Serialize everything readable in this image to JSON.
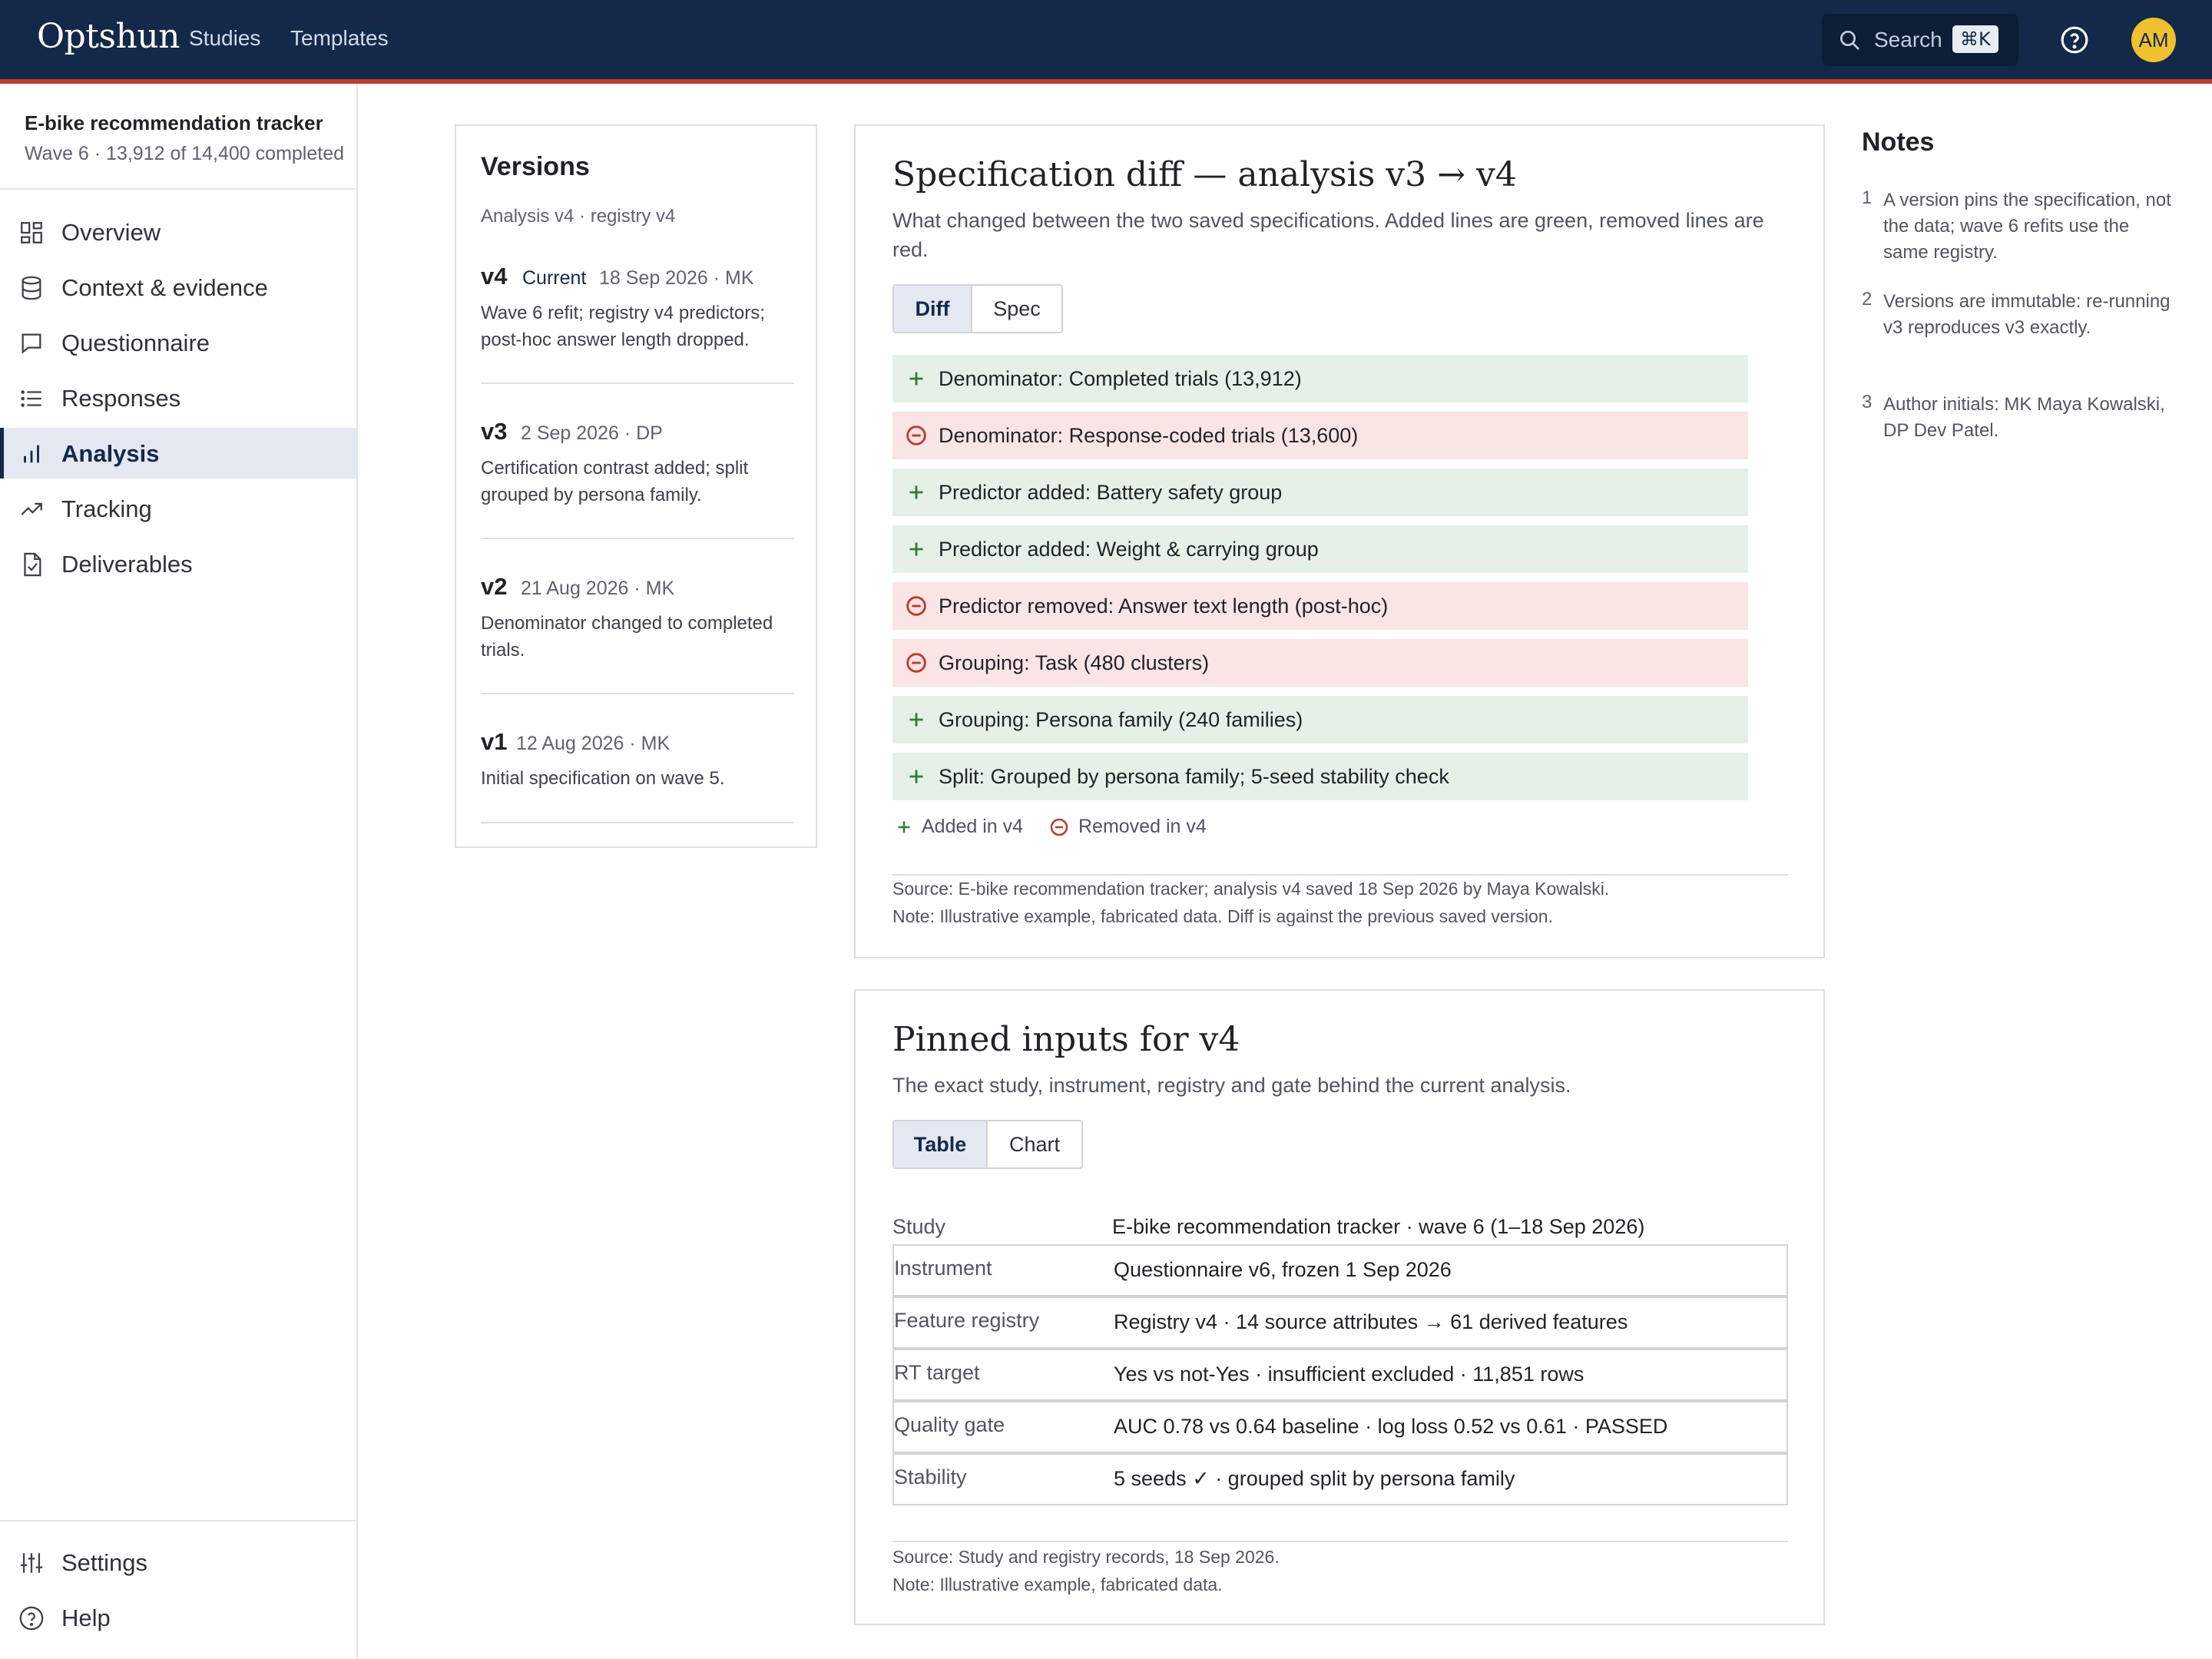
{
  "app": {
    "name": "Optshun",
    "nav": [
      "Studies",
      "Templates"
    ],
    "search_label": "Search",
    "search_shortcut": "⌘K",
    "user_initials": "AM"
  },
  "colors": {
    "topbar": "#12294a",
    "accent_rule": "#c8362e",
    "added_bg": "#e5f1e7",
    "removed_bg": "#fbe5e4",
    "added_icon": "#2e7d3a",
    "removed_icon": "#c0392b",
    "avatar": "#efc02f"
  },
  "sidebar": {
    "project_title": "E-bike recommendation tracker",
    "project_sub": "Wave 6 · 13,912 of 14,400 completed",
    "items": [
      {
        "label": "Overview",
        "icon": "grid-icon"
      },
      {
        "label": "Context & evidence",
        "icon": "database-icon"
      },
      {
        "label": "Questionnaire",
        "icon": "chat-icon"
      },
      {
        "label": "Responses",
        "icon": "list-icon"
      },
      {
        "label": "Analysis",
        "icon": "bar-chart-icon",
        "active": true
      },
      {
        "label": "Tracking",
        "icon": "trending-icon"
      },
      {
        "label": "Deliverables",
        "icon": "document-check-icon"
      }
    ],
    "bottom": [
      {
        "label": "Settings",
        "icon": "sliders-icon"
      },
      {
        "label": "Help",
        "icon": "help-icon"
      }
    ]
  },
  "versions": {
    "title": "Versions",
    "subtitle": "Analysis v4 · registry v4",
    "current_label": "Current",
    "list": [
      {
        "num": "v4",
        "meta": "18 Sep 2026 · MK",
        "desc": "Wave 6 refit; registry v4 predictors; post-hoc answer length dropped."
      },
      {
        "num": "v3",
        "meta": "2 Sep 2026 · DP",
        "desc": "Certification contrast added; split grouped by persona family."
      },
      {
        "num": "v2",
        "meta": "21 Aug 2026 · MK",
        "desc": "Denominator changed to completed trials."
      },
      {
        "num": "v1",
        "meta": "12 Aug 2026 · MK",
        "desc": "Initial specification on wave 5."
      }
    ]
  },
  "diff": {
    "title": "Specification diff — analysis v3 → v4",
    "subtitle": "What changed between the two saved specifications. Added lines are green, removed lines are red.",
    "tabs": [
      "Diff",
      "Spec"
    ],
    "rows": [
      {
        "kind": "add",
        "text": "Denominator: Completed trials (13,912)"
      },
      {
        "kind": "rem",
        "text": "Denominator: Response-coded trials (13,600)"
      },
      {
        "kind": "add",
        "text": "Predictor added: Battery safety group"
      },
      {
        "kind": "add",
        "text": "Predictor added: Weight & carrying group"
      },
      {
        "kind": "rem",
        "text": "Predictor removed: Answer text length (post-hoc)"
      },
      {
        "kind": "rem",
        "text": "Grouping: Task (480 clusters)"
      },
      {
        "kind": "add",
        "text": "Grouping: Persona family (240 families)"
      },
      {
        "kind": "add",
        "text": "Split: Grouped by persona family; 5-seed stability check"
      }
    ],
    "legend_added": "Added in v4",
    "legend_removed": "Removed in v4",
    "source": "Source: E-bike recommendation tracker; analysis v4 saved 18 Sep 2026 by Maya Kowalski.",
    "note": "Note: Illustrative example, fabricated data. Diff is against the previous saved version."
  },
  "pinned": {
    "title": "Pinned inputs for v4",
    "subtitle": "The exact study, instrument, registry and gate behind the current analysis.",
    "tabs": [
      "Table",
      "Chart"
    ],
    "rows": [
      {
        "key": "Study",
        "value": "E-bike recommendation tracker · wave 6 (1–18 Sep 2026)"
      },
      {
        "key": "Instrument",
        "value": "Questionnaire v6, frozen 1 Sep 2026"
      },
      {
        "key": "Feature registry",
        "value": "Registry v4 · 14 source attributes → 61 derived features"
      },
      {
        "key": "RT target",
        "value": "Yes vs not-Yes · insufficient excluded · 11,851 rows"
      },
      {
        "key": "Quality gate",
        "value": "AUC 0.78 vs 0.64 baseline · log loss 0.52 vs 0.61 · PASSED"
      },
      {
        "key": "Stability",
        "value": "5 seeds ✓ · grouped split by persona family"
      }
    ],
    "source": "Source: Study and registry records, 18 Sep 2026.",
    "note": "Note: Illustrative example, fabricated data."
  },
  "notes": {
    "title": "Notes",
    "items": [
      {
        "n": "1",
        "text": "A version pins the specification, not the data; wave 6 refits use the same registry."
      },
      {
        "n": "2",
        "text": "Versions are immutable: re-running v3 reproduces v3 exactly."
      },
      {
        "n": "3",
        "text": "Author initials: MK Maya Kowalski, DP Dev Patel."
      }
    ]
  }
}
